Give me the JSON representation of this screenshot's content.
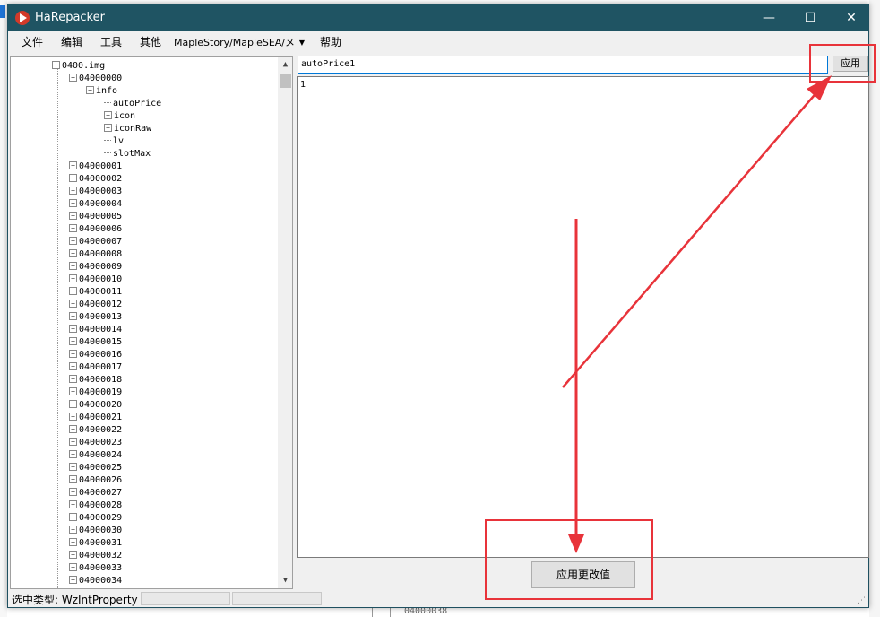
{
  "window": {
    "title": "HaRepacker",
    "minimize_glyph": "—",
    "maximize_glyph": "☐",
    "close_glyph": "✕"
  },
  "menu": {
    "items": [
      "文件",
      "编辑",
      "工具",
      "其他"
    ],
    "combo_value": "MapleStory/MapleSEA/メ",
    "combo_arrow": "▼",
    "help": "帮助"
  },
  "tree": {
    "root": "0400.img",
    "expanded_item": "04000000",
    "info": "info",
    "info_children": [
      "autoPrice",
      "icon",
      "iconRaw",
      "lv",
      "slotMax"
    ],
    "info_children_expandable": [
      false,
      true,
      true,
      false,
      false
    ],
    "items": [
      "04000001",
      "04000002",
      "04000003",
      "04000004",
      "04000005",
      "04000006",
      "04000007",
      "04000008",
      "04000009",
      "04000010",
      "04000011",
      "04000012",
      "04000013",
      "04000014",
      "04000015",
      "04000016",
      "04000017",
      "04000018",
      "04000019",
      "04000020",
      "04000021",
      "04000022",
      "04000023",
      "04000024",
      "04000025",
      "04000026",
      "04000027",
      "04000028",
      "04000029",
      "04000030",
      "04000031",
      "04000032",
      "04000033",
      "04000034"
    ],
    "scroll_up": "▲",
    "scroll_down": "▼"
  },
  "editor": {
    "name_value": "autoPrice1",
    "apply_label": "应用",
    "value_text": "1",
    "apply_changes_label": "应用更改值"
  },
  "status": {
    "selected_type": "选中类型: WzIntProperty",
    "grip": "⋰"
  },
  "background": {
    "bottom_node": "04000038"
  },
  "colors": {
    "titlebar": "#1f5463",
    "annotation_red": "#e8333a",
    "input_focus": "#0078d7"
  }
}
